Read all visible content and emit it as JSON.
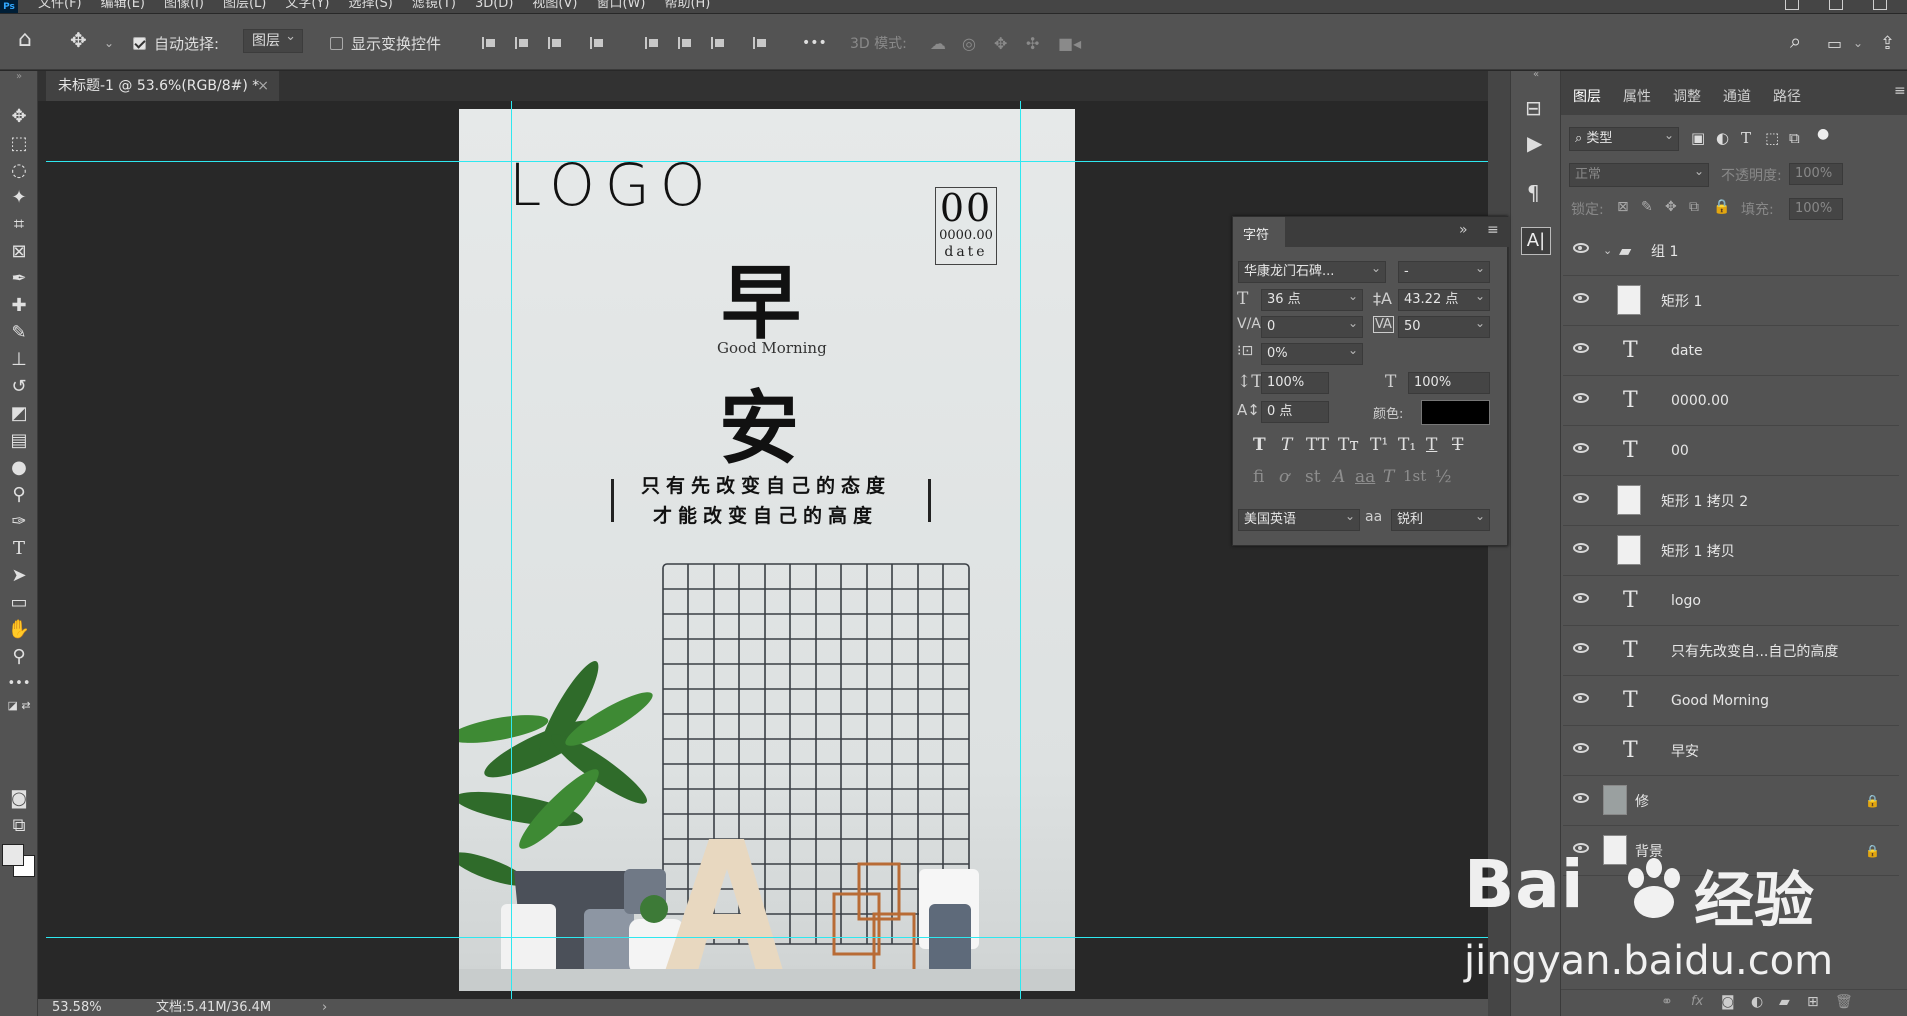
{
  "app": {
    "logo": "Ps"
  },
  "menu": [
    "文件(F)",
    "编辑(E)",
    "图像(I)",
    "图层(L)",
    "文字(Y)",
    "选择(S)",
    "滤镜(T)",
    "3D(D)",
    "视图(V)",
    "窗口(W)",
    "帮助(H)"
  ],
  "options": {
    "auto_select_label": "自动选择:",
    "auto_select_target": "图层",
    "show_transform_label": "显示变换控件",
    "mode_3d_label": "3D 模式:",
    "more": "•••"
  },
  "document": {
    "tab_title": "未标题-1 @ 53.6%(RGB/8#) *",
    "zoom": "53.58%",
    "doc_size": "文档:5.41M/36.4M"
  },
  "poster": {
    "logo": "LOGO",
    "day": "00",
    "number": "0000.00",
    "date": "date",
    "char1": "早",
    "subtitle": "Good Morning",
    "char2": "安",
    "line1": "只有先改变自己的态度",
    "line2": "才能改变自己的高度",
    "badge_letter": "A"
  },
  "layers_panel": {
    "tabs": [
      "图层",
      "属性",
      "调整",
      "通道",
      "路径"
    ],
    "filter_kind": "类型",
    "blend_mode": "正常",
    "opacity_label": "不透明度:",
    "opacity_value": "100%",
    "lock_label": "锁定:",
    "fill_label": "填充:",
    "fill_value": "100%",
    "layers": [
      {
        "name": "组 1",
        "type": "group"
      },
      {
        "name": "矩形 1",
        "type": "shape"
      },
      {
        "name": "date",
        "type": "text"
      },
      {
        "name": "0000.00",
        "type": "text"
      },
      {
        "name": "00",
        "type": "text"
      },
      {
        "name": "矩形 1 拷贝 2",
        "type": "shape"
      },
      {
        "name": "矩形 1 拷贝",
        "type": "shape"
      },
      {
        "name": "logo",
        "type": "text"
      },
      {
        "name": "只有先改变自...自己的高度",
        "type": "text"
      },
      {
        "name": "Good Morning",
        "type": "text"
      },
      {
        "name": "早安",
        "type": "text"
      },
      {
        "name": "修",
        "type": "image",
        "locked": true
      },
      {
        "name": "背景",
        "type": "image",
        "locked": true
      }
    ]
  },
  "character_panel": {
    "title": "字符",
    "font_family": "华康龙门石碑...",
    "font_style": "-",
    "font_size": "36 点",
    "leading": "43.22 点",
    "kerning": "0",
    "tracking": "50",
    "tsume": "0%",
    "vertical_scale": "100%",
    "horizontal_scale": "100%",
    "baseline_shift": "0 点",
    "color_label": "颜色:",
    "color_value": "#000000",
    "language": "美国英语",
    "antialias_label": "aa",
    "antialias": "锐利",
    "style_buttons": [
      "T",
      "T",
      "TT",
      "Tт",
      "T¹",
      "T₁",
      "T",
      "T"
    ],
    "opentype_buttons": [
      "ﬁ",
      "ơ",
      "st",
      "A",
      "aa",
      "T",
      "1st",
      "½"
    ]
  },
  "watermark": {
    "brand": "Bai",
    "brand2": "经验",
    "url": "jingyan.baidu.com"
  }
}
